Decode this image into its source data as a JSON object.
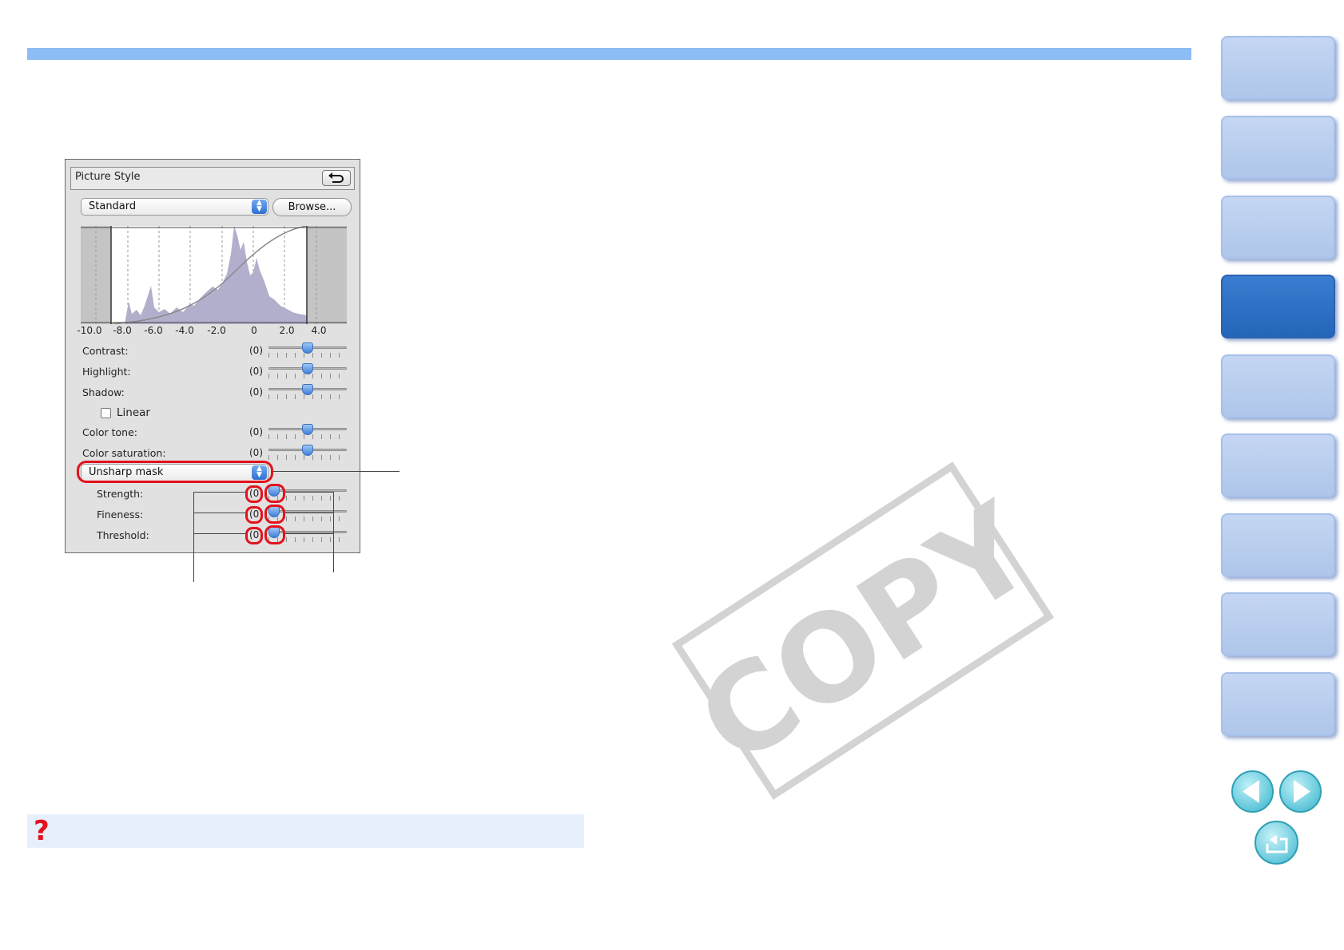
{
  "panel": {
    "title": "Picture Style",
    "style_select": "Standard",
    "browse_label": "Browse...",
    "axis_labels": [
      "-10.0",
      "-8.0",
      "-6.0",
      "-4.0",
      "-2.0",
      "0",
      "2.0",
      "4.0"
    ],
    "rows": [
      {
        "label": "Contrast:",
        "value": "(0)",
        "level": 0.5
      },
      {
        "label": "Highlight:",
        "value": "(0)",
        "level": 0.5
      },
      {
        "label": "Shadow:",
        "value": "(0)",
        "level": 0.5
      },
      {
        "label": "Color tone:",
        "value": "(0)",
        "level": 0.5
      },
      {
        "label": "Color saturation:",
        "value": "(0)",
        "level": 0.5
      }
    ],
    "linear_label": "Linear",
    "sharpness_select": "Unsharp mask",
    "sharp_rows": [
      {
        "label": "Strength:",
        "value": "(0)",
        "level": 0.0
      },
      {
        "label": "Fineness:",
        "value": "(0)",
        "level": 0.0
      },
      {
        "label": "Threshold:",
        "value": "(0)",
        "level": 0.0
      }
    ]
  },
  "watermark": "COPY",
  "hint_icon": "?",
  "side_tabs": {
    "count": 9,
    "active_index": 3
  },
  "icons": {
    "reset": "undo-arrow-icon",
    "prev": "previous-page-icon",
    "next": "next-page-icon",
    "home": "return-icon",
    "hint": "question-mark-icon"
  },
  "colors": {
    "highlight": "#e2121d",
    "accent": "#8cbdf5",
    "active_tab": "#2465b9"
  }
}
